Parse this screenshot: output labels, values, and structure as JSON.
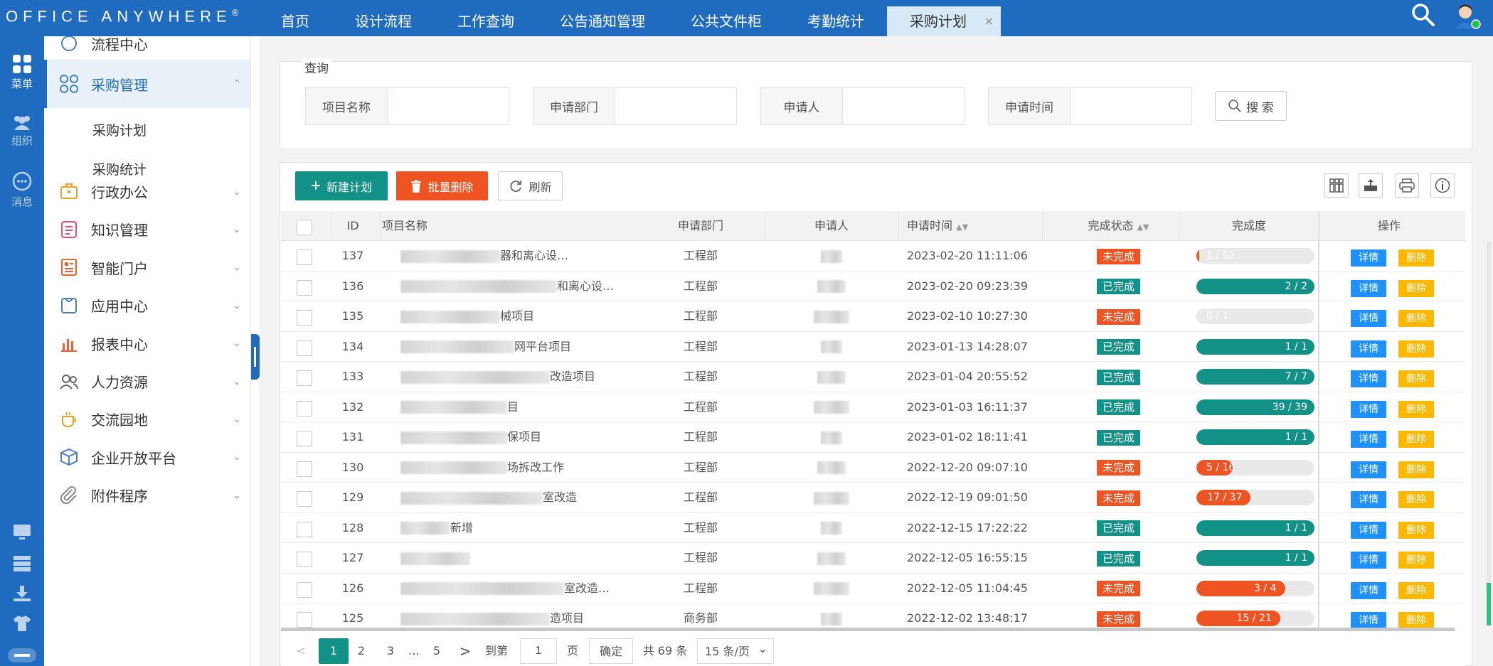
{
  "app": {
    "logo": "Office Anywhere",
    "logo_mark": "®"
  },
  "nav": {
    "tabs": [
      {
        "label": "首页"
      },
      {
        "label": "设计流程"
      },
      {
        "label": "工作查询"
      },
      {
        "label": "公告通知管理"
      },
      {
        "label": "公共文件柜"
      },
      {
        "label": "考勤统计"
      },
      {
        "label": "采购计划",
        "active": true,
        "close": "×"
      }
    ]
  },
  "iconbar": {
    "menu": "菜单",
    "org": "组织",
    "msg": "消息"
  },
  "menu": {
    "partial_top": "流程中心",
    "open_group": "采购管理",
    "sub_items": [
      "采购计划",
      "采购统计"
    ],
    "groups": [
      "行政办公",
      "知识管理",
      "智能门户",
      "应用中心",
      "报表中心",
      "人力资源",
      "交流园地",
      "企业开放平台",
      "附件程序"
    ],
    "chevron": "⌄",
    "chevron_up": "⌃"
  },
  "query": {
    "title": "查询",
    "fields": [
      {
        "label": "项目名称",
        "value": ""
      },
      {
        "label": "申请部门",
        "value": ""
      },
      {
        "label": "申请人",
        "value": ""
      },
      {
        "label": "申请时间",
        "value": ""
      }
    ],
    "search_btn": "搜 索"
  },
  "toolbar": {
    "new": "新建计划",
    "batch_delete": "批量删除",
    "refresh": "刷新"
  },
  "table": {
    "headers": {
      "id": "ID",
      "name": "项目名称",
      "dept": "申请部门",
      "person": "申请人",
      "time": "申请时间",
      "status": "完成状态",
      "progress": "完成度",
      "ops": "操作"
    },
    "btn_detail": "详情",
    "btn_delete": "删除",
    "rows": [
      {
        "id": "137",
        "name": "器和离心设…",
        "dept": "工程部",
        "time": "2023-02-20 11:11:06",
        "status": "未完成",
        "done": 1,
        "total": 52,
        "pct": 0.02,
        "prog": "1 / 52"
      },
      {
        "id": "136",
        "name": "和离心设…",
        "dept": "工程部",
        "time": "2023-02-20 09:23:39",
        "status": "已完成",
        "done": 2,
        "total": 2,
        "pct": 1,
        "prog": "2 / 2"
      },
      {
        "id": "135",
        "name": "械项目",
        "dept": "工程部",
        "time": "2023-02-10 10:27:30",
        "status": "未完成",
        "done": 0,
        "total": 1,
        "pct": 0,
        "prog": "0 / 1"
      },
      {
        "id": "134",
        "name": "网平台项目",
        "dept": "工程部",
        "time": "2023-01-13 14:28:07",
        "status": "已完成",
        "done": 1,
        "total": 1,
        "pct": 1,
        "prog": "1 / 1"
      },
      {
        "id": "133",
        "name": "改造项目",
        "dept": "工程部",
        "time": "2023-01-04 20:55:52",
        "status": "已完成",
        "done": 7,
        "total": 7,
        "pct": 1,
        "prog": "7 / 7"
      },
      {
        "id": "132",
        "name": "目",
        "dept": "工程部",
        "time": "2023-01-03 16:11:37",
        "status": "已完成",
        "done": 39,
        "total": 39,
        "pct": 1,
        "prog": "39 / 39"
      },
      {
        "id": "131",
        "name": "保项目",
        "dept": "工程部",
        "time": "2023-01-02 18:11:41",
        "status": "已完成",
        "done": 1,
        "total": 1,
        "pct": 1,
        "prog": "1 / 1"
      },
      {
        "id": "130",
        "name": "场拆改工作",
        "dept": "工程部",
        "time": "2022-12-20 09:07:10",
        "status": "未完成",
        "done": 5,
        "total": 16,
        "pct": 0.31,
        "prog": "5 / 16"
      },
      {
        "id": "129",
        "name": "室改造",
        "dept": "工程部",
        "time": "2022-12-19 09:01:50",
        "status": "未完成",
        "done": 17,
        "total": 37,
        "pct": 0.46,
        "prog": "17 / 37"
      },
      {
        "id": "128",
        "name": "新增",
        "dept": "工程部",
        "time": "2022-12-15 17:22:22",
        "status": "已完成",
        "done": 1,
        "total": 1,
        "pct": 1,
        "prog": "1 / 1"
      },
      {
        "id": "127",
        "name": "",
        "dept": "工程部",
        "time": "2022-12-05 16:55:15",
        "status": "已完成",
        "done": 1,
        "total": 1,
        "pct": 1,
        "prog": "1 / 1"
      },
      {
        "id": "126",
        "name": "室改造…",
        "dept": "工程部",
        "time": "2022-12-05 11:04:45",
        "status": "未完成",
        "done": 3,
        "total": 4,
        "pct": 0.75,
        "prog": "3 / 4"
      },
      {
        "id": "125",
        "name": "造项目",
        "dept": "商务部",
        "time": "2022-12-02 13:48:17",
        "status": "未完成",
        "done": 15,
        "total": 21,
        "pct": 0.71,
        "prog": "15 / 21"
      }
    ]
  },
  "pager": {
    "prev": "<",
    "pages": [
      "1",
      "2",
      "3",
      "…",
      "5"
    ],
    "next": ">",
    "goto_label": "到第",
    "goto_value": "1",
    "page_unit": "页",
    "confirm": "确定",
    "total": "共 69 条",
    "per_page": "15 条/页"
  },
  "colors": {
    "primary": "#1e6bc0",
    "teal": "#129186",
    "orange": "#f05322",
    "blue": "#1e90ff",
    "yellow": "#ffb800"
  }
}
